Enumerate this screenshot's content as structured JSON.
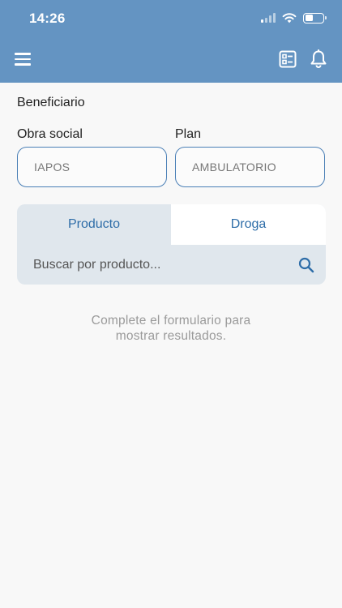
{
  "status_bar": {
    "time": "14:26"
  },
  "header": {
    "menu_icon": "hamburger-menu-icon",
    "list_icon": "checklist-icon",
    "bell_icon": "bell-icon",
    "background": "#6494c2"
  },
  "form": {
    "beneficiario_label": "Beneficiario",
    "obra_social_label": "Obra social",
    "obra_social_value": "IAPOS",
    "plan_label": "Plan",
    "plan_value": "AMBULATORIO"
  },
  "tabs": {
    "items": [
      {
        "label": "Producto",
        "active": true
      },
      {
        "label": "Droga",
        "active": false
      }
    ]
  },
  "search": {
    "placeholder": "Buscar por producto...",
    "value": ""
  },
  "empty_state": {
    "line1": "Complete el formulario para",
    "line2": "mostrar resultados."
  },
  "colors": {
    "accent": "#2e6da8",
    "header": "#6494c2",
    "field_border": "#4a7fb6"
  }
}
